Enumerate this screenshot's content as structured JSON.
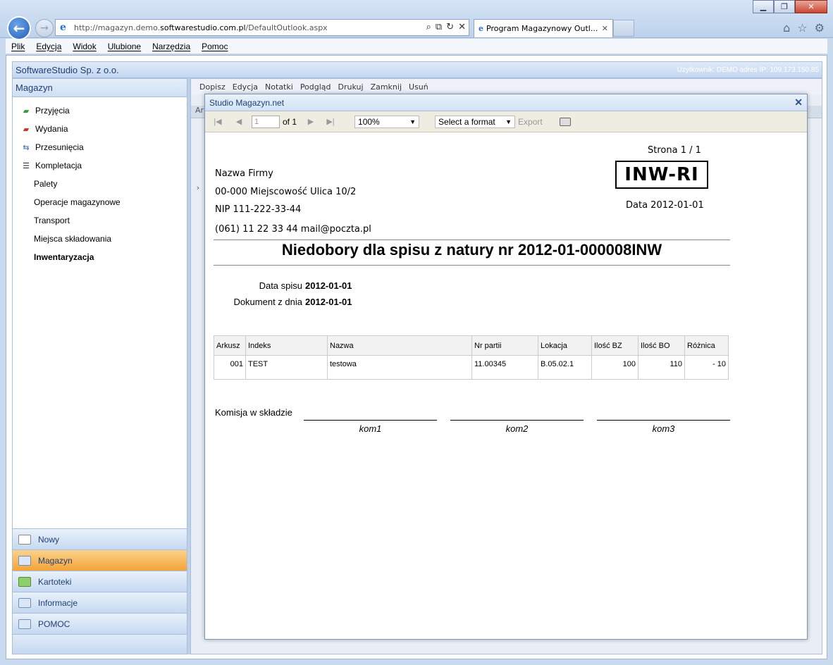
{
  "browser": {
    "address_prefix": "http://magazyn.demo.",
    "address_host": "softwarestudio.com.pl",
    "address_suffix": "/DefaultOutlook.aspx",
    "tab_title": "Program Magazynowy Outl...",
    "menu": [
      "Plik",
      "Edycja",
      "Widok",
      "Ulubione",
      "Narzędzia",
      "Pomoc"
    ]
  },
  "app": {
    "title": "SoftwareStudio Sp. z o.o.",
    "user_info": "Użytkownik: DEMO adres IP: 109.173.150.85"
  },
  "sidebar": {
    "header": "Magazyn",
    "items": [
      {
        "label": "Przyjęcia",
        "icon": "receipt-icon"
      },
      {
        "label": "Wydania",
        "icon": "issue-icon"
      },
      {
        "label": "Przesunięcia",
        "icon": "transfer-icon"
      },
      {
        "label": "Kompletacja",
        "icon": "list-icon"
      },
      {
        "label": "Palety"
      },
      {
        "label": "Operacje magazynowe"
      },
      {
        "label": "Transport"
      },
      {
        "label": "Miejsca składowania"
      },
      {
        "label": "Inwentaryzacja"
      }
    ],
    "bottom_buttons": [
      {
        "label": "Nowy"
      },
      {
        "label": "Magazyn"
      },
      {
        "label": "Kartoteki"
      },
      {
        "label": "Informacje"
      },
      {
        "label": "POMOC"
      }
    ]
  },
  "main": {
    "toolbar": [
      "Dopisz",
      "Edycja",
      "Notatki",
      "Podgląd",
      "Drukuj",
      "Zamknij",
      "Usuń"
    ],
    "grid_header": "Ark"
  },
  "modal": {
    "title": "Studio Magazyn.net",
    "page_value": "1",
    "page_of": "of 1",
    "zoom": "100%",
    "format_placeholder": "Select a format",
    "export_label": "Export"
  },
  "report": {
    "page": "Strona 1 / 1",
    "company_name": "Nazwa Firmy",
    "company_address": "00-000 Miejscowość Ulica 10/2",
    "company_nip": "NIP 111-222-33-44",
    "company_contact": "(061) 11 22 33 44 mail@poczta.pl",
    "doc_code": "INW-RI",
    "doc_date": "Data 2012-01-01",
    "title": "Niedobory dla spisu z natury nr 2012-01-000008INW",
    "data_spisu_label": "Data spisu",
    "data_spisu_value": "2012-01-01",
    "dokument_label": "Dokument z dnia",
    "dokument_value": "2012-01-01",
    "table": {
      "headers": [
        "Arkusz",
        "Indeks",
        "Nazwa",
        "Nr partii",
        "Lokacja",
        "Ilość BZ",
        "Ilość BO",
        "Różnica"
      ],
      "rows": [
        [
          "001",
          "TEST",
          "testowa",
          "11.00345",
          "B.05.02.1",
          "100",
          "110",
          "- 10"
        ]
      ]
    },
    "komisja_label": "Komisja w składzie",
    "signatures": [
      "kom1",
      "kom2",
      "kom3"
    ]
  }
}
